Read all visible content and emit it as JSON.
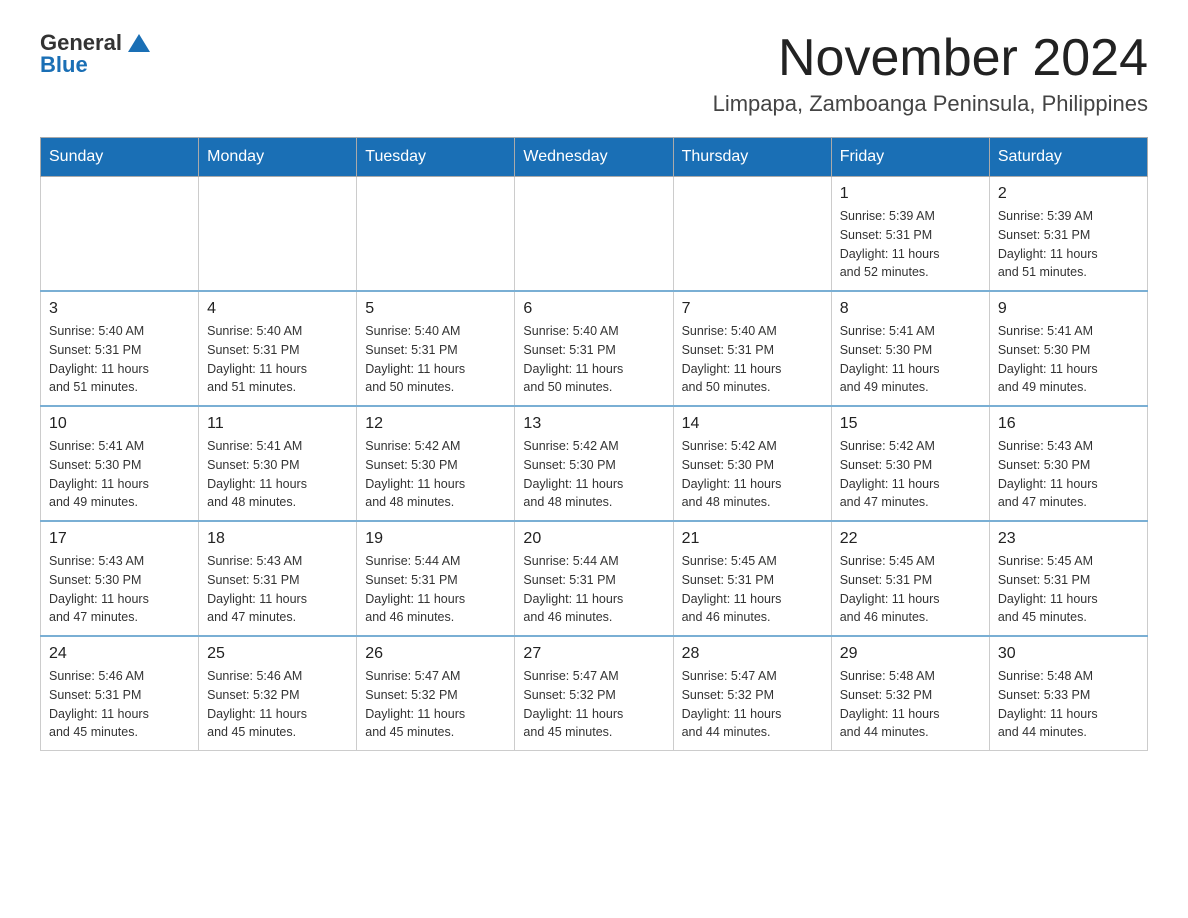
{
  "header": {
    "logo_general": "General",
    "logo_blue": "Blue",
    "month_title": "November 2024",
    "location": "Limpapa, Zamboanga Peninsula, Philippines"
  },
  "days_of_week": [
    "Sunday",
    "Monday",
    "Tuesday",
    "Wednesday",
    "Thursday",
    "Friday",
    "Saturday"
  ],
  "weeks": [
    [
      {
        "day": "",
        "info": ""
      },
      {
        "day": "",
        "info": ""
      },
      {
        "day": "",
        "info": ""
      },
      {
        "day": "",
        "info": ""
      },
      {
        "day": "",
        "info": ""
      },
      {
        "day": "1",
        "info": "Sunrise: 5:39 AM\nSunset: 5:31 PM\nDaylight: 11 hours\nand 52 minutes."
      },
      {
        "day": "2",
        "info": "Sunrise: 5:39 AM\nSunset: 5:31 PM\nDaylight: 11 hours\nand 51 minutes."
      }
    ],
    [
      {
        "day": "3",
        "info": "Sunrise: 5:40 AM\nSunset: 5:31 PM\nDaylight: 11 hours\nand 51 minutes."
      },
      {
        "day": "4",
        "info": "Sunrise: 5:40 AM\nSunset: 5:31 PM\nDaylight: 11 hours\nand 51 minutes."
      },
      {
        "day": "5",
        "info": "Sunrise: 5:40 AM\nSunset: 5:31 PM\nDaylight: 11 hours\nand 50 minutes."
      },
      {
        "day": "6",
        "info": "Sunrise: 5:40 AM\nSunset: 5:31 PM\nDaylight: 11 hours\nand 50 minutes."
      },
      {
        "day": "7",
        "info": "Sunrise: 5:40 AM\nSunset: 5:31 PM\nDaylight: 11 hours\nand 50 minutes."
      },
      {
        "day": "8",
        "info": "Sunrise: 5:41 AM\nSunset: 5:30 PM\nDaylight: 11 hours\nand 49 minutes."
      },
      {
        "day": "9",
        "info": "Sunrise: 5:41 AM\nSunset: 5:30 PM\nDaylight: 11 hours\nand 49 minutes."
      }
    ],
    [
      {
        "day": "10",
        "info": "Sunrise: 5:41 AM\nSunset: 5:30 PM\nDaylight: 11 hours\nand 49 minutes."
      },
      {
        "day": "11",
        "info": "Sunrise: 5:41 AM\nSunset: 5:30 PM\nDaylight: 11 hours\nand 48 minutes."
      },
      {
        "day": "12",
        "info": "Sunrise: 5:42 AM\nSunset: 5:30 PM\nDaylight: 11 hours\nand 48 minutes."
      },
      {
        "day": "13",
        "info": "Sunrise: 5:42 AM\nSunset: 5:30 PM\nDaylight: 11 hours\nand 48 minutes."
      },
      {
        "day": "14",
        "info": "Sunrise: 5:42 AM\nSunset: 5:30 PM\nDaylight: 11 hours\nand 48 minutes."
      },
      {
        "day": "15",
        "info": "Sunrise: 5:42 AM\nSunset: 5:30 PM\nDaylight: 11 hours\nand 47 minutes."
      },
      {
        "day": "16",
        "info": "Sunrise: 5:43 AM\nSunset: 5:30 PM\nDaylight: 11 hours\nand 47 minutes."
      }
    ],
    [
      {
        "day": "17",
        "info": "Sunrise: 5:43 AM\nSunset: 5:30 PM\nDaylight: 11 hours\nand 47 minutes."
      },
      {
        "day": "18",
        "info": "Sunrise: 5:43 AM\nSunset: 5:31 PM\nDaylight: 11 hours\nand 47 minutes."
      },
      {
        "day": "19",
        "info": "Sunrise: 5:44 AM\nSunset: 5:31 PM\nDaylight: 11 hours\nand 46 minutes."
      },
      {
        "day": "20",
        "info": "Sunrise: 5:44 AM\nSunset: 5:31 PM\nDaylight: 11 hours\nand 46 minutes."
      },
      {
        "day": "21",
        "info": "Sunrise: 5:45 AM\nSunset: 5:31 PM\nDaylight: 11 hours\nand 46 minutes."
      },
      {
        "day": "22",
        "info": "Sunrise: 5:45 AM\nSunset: 5:31 PM\nDaylight: 11 hours\nand 46 minutes."
      },
      {
        "day": "23",
        "info": "Sunrise: 5:45 AM\nSunset: 5:31 PM\nDaylight: 11 hours\nand 45 minutes."
      }
    ],
    [
      {
        "day": "24",
        "info": "Sunrise: 5:46 AM\nSunset: 5:31 PM\nDaylight: 11 hours\nand 45 minutes."
      },
      {
        "day": "25",
        "info": "Sunrise: 5:46 AM\nSunset: 5:32 PM\nDaylight: 11 hours\nand 45 minutes."
      },
      {
        "day": "26",
        "info": "Sunrise: 5:47 AM\nSunset: 5:32 PM\nDaylight: 11 hours\nand 45 minutes."
      },
      {
        "day": "27",
        "info": "Sunrise: 5:47 AM\nSunset: 5:32 PM\nDaylight: 11 hours\nand 45 minutes."
      },
      {
        "day": "28",
        "info": "Sunrise: 5:47 AM\nSunset: 5:32 PM\nDaylight: 11 hours\nand 44 minutes."
      },
      {
        "day": "29",
        "info": "Sunrise: 5:48 AM\nSunset: 5:32 PM\nDaylight: 11 hours\nand 44 minutes."
      },
      {
        "day": "30",
        "info": "Sunrise: 5:48 AM\nSunset: 5:33 PM\nDaylight: 11 hours\nand 44 minutes."
      }
    ]
  ]
}
